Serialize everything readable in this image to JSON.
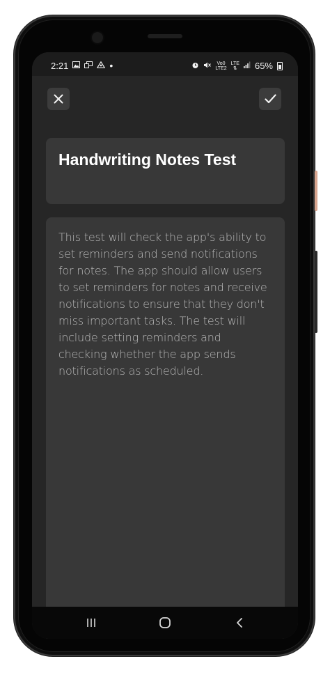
{
  "status_bar": {
    "time": "2:21",
    "battery_percent": "65%",
    "signal_label_top": "Vo0",
    "signal_label_bottom": "LTE2",
    "lte_label": "LTE",
    "icons": [
      "gallery-icon",
      "cast-icon",
      "drive-icon",
      "notification-dot-icon",
      "alarm-icon",
      "mute-icon",
      "signal-icon",
      "battery-icon"
    ]
  },
  "toolbar": {
    "close_icon": "close-icon",
    "confirm_icon": "check-icon"
  },
  "note": {
    "title": "Handwriting Notes Test",
    "body": "This test will check the app's ability to set reminders and send notifications for notes. The app should allow users to set reminders for notes and receive notifications to ensure that they don't miss important tasks. The test will include setting reminders and checking whether the app sends notifications as scheduled."
  },
  "nav": {
    "recents_icon": "recents-icon",
    "home_icon": "home-icon",
    "back_icon": "back-icon"
  },
  "colors": {
    "screen_bg": "#262626",
    "card_bg": "#383838",
    "title_text": "#ffffff",
    "body_text": "#b9b9b9"
  }
}
